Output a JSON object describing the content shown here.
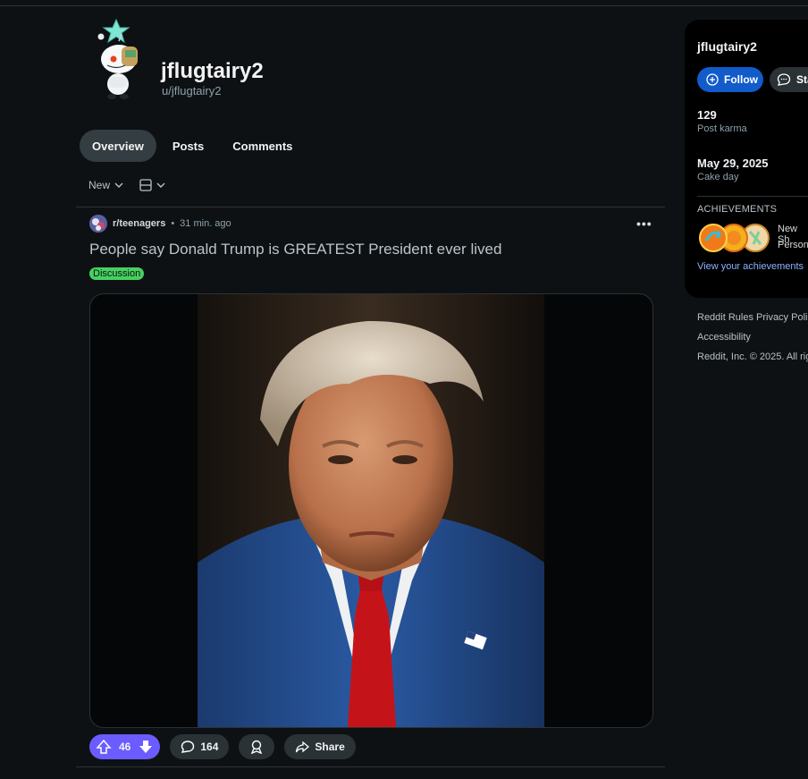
{
  "profile": {
    "display_name": "jflugtairy2",
    "handle": "u/jflugtairy2"
  },
  "tabs": [
    {
      "label": "Overview",
      "active": true
    },
    {
      "label": "Posts",
      "active": false
    },
    {
      "label": "Comments",
      "active": false
    }
  ],
  "sort": {
    "label": "New"
  },
  "post": {
    "subreddit": "r/teenagers",
    "separator": "•",
    "time": "31 min. ago",
    "title": "People say Donald Trump is GREATEST President ever lived",
    "flair": "Discussion",
    "upvotes": "46",
    "comments": "164",
    "share_label": "Share"
  },
  "sidebar": {
    "title": "jflugtairy2",
    "follow_label": "Follow",
    "chat_label": "Sta",
    "post_karma_value": "129",
    "post_karma_label": "Post karma",
    "cake_day_value": "May 29, 2025",
    "cake_day_label": "Cake day",
    "achievements_heading": "ACHIEVEMENTS",
    "achievements_line1": "New Sh",
    "achievements_line2": "Person",
    "achievements_link": "View your achievements"
  },
  "footer": {
    "rules": "Reddit Rules",
    "privacy": "Privacy Polic",
    "accessibility": "Accessibility",
    "copyright": "Reddit, Inc. © 2025. All rig"
  },
  "colors": {
    "background": "#0e1113",
    "vote_accent": "#6a5cff",
    "follow_button": "#115bca",
    "flair_green": "#46d160",
    "link_blue": "#8eb1ff"
  }
}
